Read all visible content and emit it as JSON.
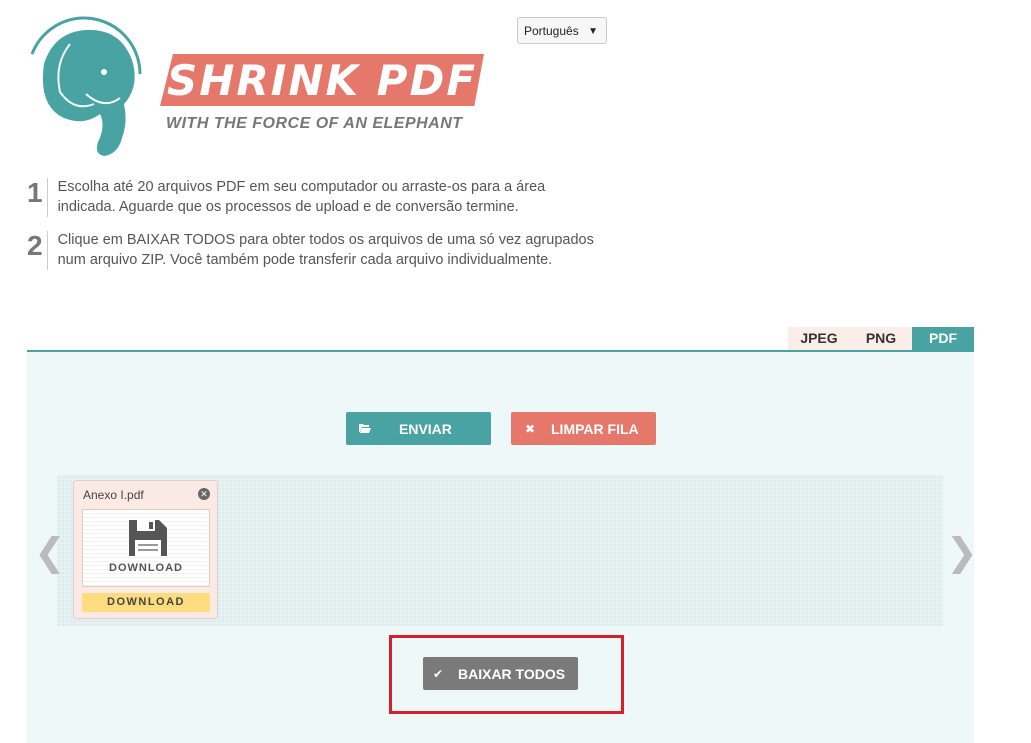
{
  "language_select": {
    "value": "Português"
  },
  "logo": {
    "title": "SHRINK PDF",
    "tagline": "WITH THE FORCE OF AN ELEPHANT"
  },
  "steps": [
    {
      "number": "1",
      "text": "Escolha até 20 arquivos PDF em seu computador ou arraste-os para a área indicada. Aguarde que os processos de upload e de conversão termine."
    },
    {
      "number": "2",
      "text": "Clique em BAIXAR TODOS para obter todos os arquivos de uma só vez agrupados num arquivo ZIP. Você também pode transferir cada arquivo individualmente."
    }
  ],
  "tabs": [
    {
      "label": "JPEG",
      "active": false
    },
    {
      "label": "PNG",
      "active": false
    },
    {
      "label": "PDF",
      "active": true
    }
  ],
  "actions": {
    "upload_label": "ENVIAR",
    "clear_label": "LIMPAR FILA",
    "download_all_label": "BAIXAR TODOS"
  },
  "queue": {
    "files": [
      {
        "name": "Anexo I.pdf",
        "thumb_label": "DOWNLOAD",
        "download_label": "DOWNLOAD"
      }
    ]
  },
  "colors": {
    "teal": "#49a3a3",
    "coral": "#e5786b",
    "gray_button": "#7a7a7a",
    "highlight_red": "#d4202a",
    "download_yellow": "#fddb7f"
  }
}
